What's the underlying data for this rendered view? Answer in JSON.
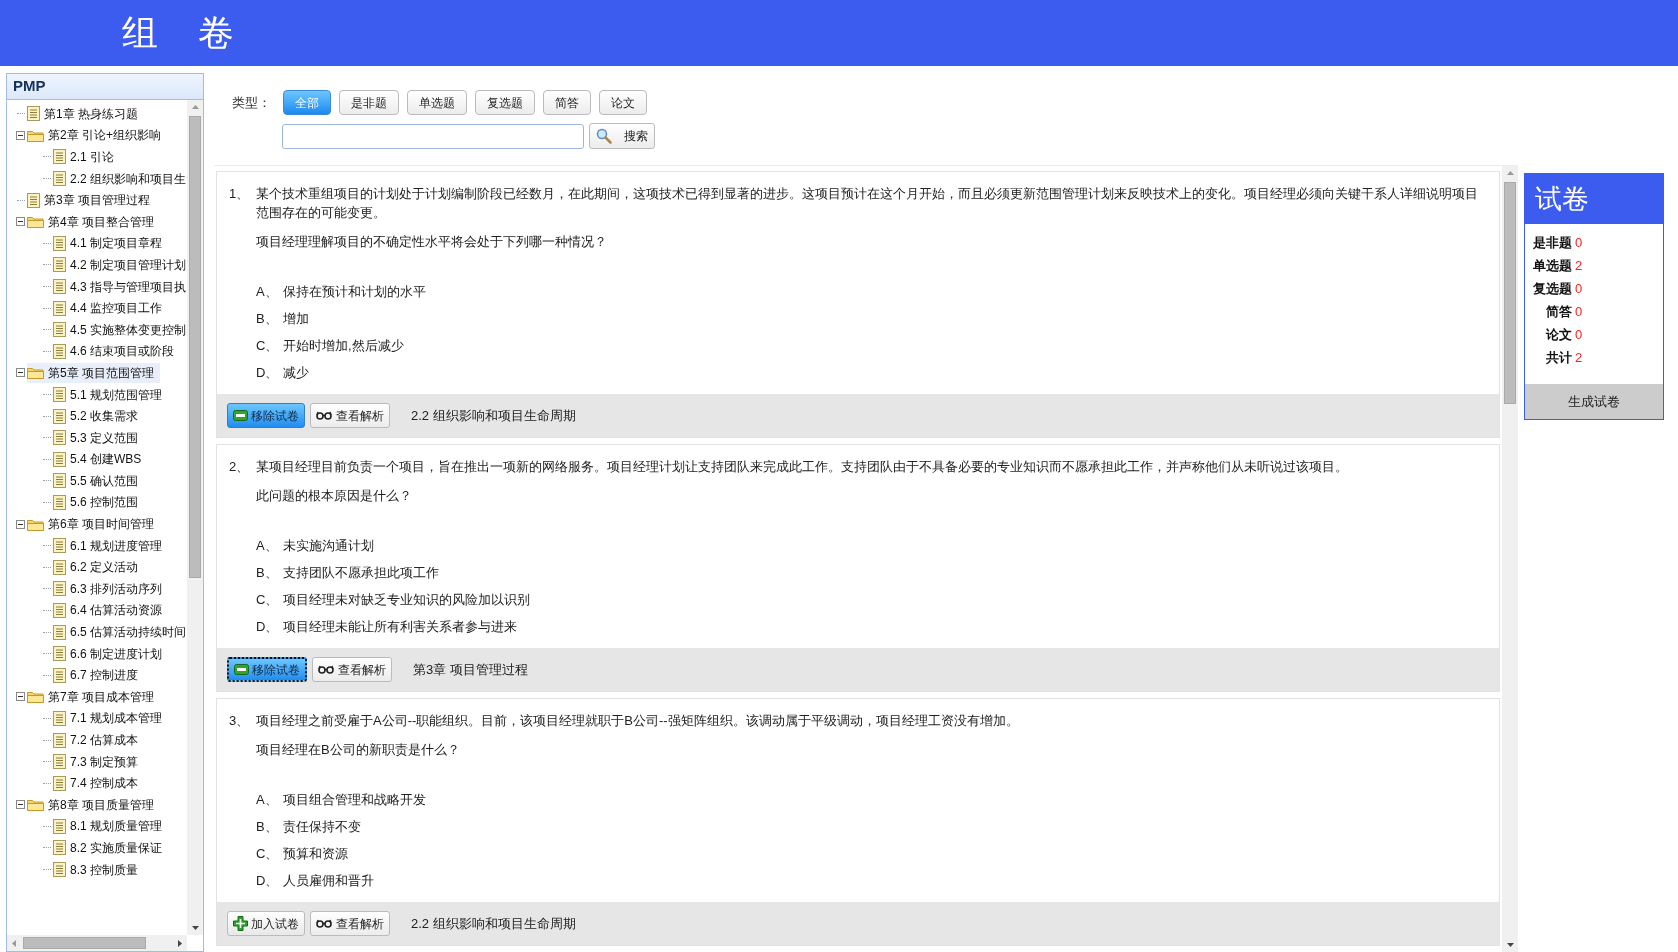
{
  "header": {
    "title": "组 卷"
  },
  "tree": {
    "title": "PMP",
    "items": [
      {
        "label": "第1章 热身练习题",
        "selected": false
      },
      {
        "label": "第2章 引论+组织影响",
        "selected": false,
        "expanded": true,
        "children": [
          {
            "label": "2.1 引论",
            "selected": false
          },
          {
            "label": "2.2 组织影响和项目生",
            "selected": false
          }
        ]
      },
      {
        "label": "第3章 项目管理过程",
        "selected": false
      },
      {
        "label": "第4章 项目整合管理",
        "selected": false,
        "expanded": true,
        "children": [
          {
            "label": "4.1 制定项目章程",
            "selected": false
          },
          {
            "label": "4.2 制定项目管理计划",
            "selected": false
          },
          {
            "label": "4.3 指导与管理项目执",
            "selected": false
          },
          {
            "label": "4.4 监控项目工作",
            "selected": false
          },
          {
            "label": "4.5 实施整体变更控制",
            "selected": false
          },
          {
            "label": "4.6 结束项目或阶段",
            "selected": false
          }
        ]
      },
      {
        "label": "第5章 项目范围管理",
        "selected": true,
        "expanded": true,
        "children": [
          {
            "label": "5.1 规划范围管理",
            "selected": false
          },
          {
            "label": "5.2 收集需求",
            "selected": false
          },
          {
            "label": "5.3 定义范围",
            "selected": false
          },
          {
            "label": "5.4 创建WBS",
            "selected": false
          },
          {
            "label": "5.5 确认范围",
            "selected": false
          },
          {
            "label": "5.6 控制范围",
            "selected": false
          }
        ]
      },
      {
        "label": "第6章 项目时间管理",
        "selected": false,
        "expanded": true,
        "children": [
          {
            "label": "6.1 规划进度管理",
            "selected": false
          },
          {
            "label": "6.2 定义活动",
            "selected": false
          },
          {
            "label": "6.3 排列活动序列",
            "selected": false
          },
          {
            "label": "6.4 估算活动资源",
            "selected": false
          },
          {
            "label": "6.5 估算活动持续时间",
            "selected": false
          },
          {
            "label": "6.6 制定进度计划",
            "selected": false
          },
          {
            "label": "6.7 控制进度",
            "selected": false
          }
        ]
      },
      {
        "label": "第7章 项目成本管理",
        "selected": false,
        "expanded": true,
        "children": [
          {
            "label": "7.1 规划成本管理",
            "selected": false
          },
          {
            "label": "7.2 估算成本",
            "selected": false
          },
          {
            "label": "7.3 制定预算",
            "selected": false
          },
          {
            "label": "7.4 控制成本",
            "selected": false
          }
        ]
      },
      {
        "label": "第8章 项目质量管理",
        "selected": false,
        "expanded": true,
        "children": [
          {
            "label": "8.1 规划质量管理",
            "selected": false
          },
          {
            "label": "8.2 实施质量保证",
            "selected": false
          },
          {
            "label": "8.3 控制质量",
            "selected": false
          }
        ]
      }
    ]
  },
  "filter": {
    "label": "类型：",
    "types": [
      {
        "label": "全部",
        "selected": true
      },
      {
        "label": "是非题",
        "selected": false
      },
      {
        "label": "单选题",
        "selected": false
      },
      {
        "label": "复选题",
        "selected": false
      },
      {
        "label": "简答",
        "selected": false
      },
      {
        "label": "论文",
        "selected": false
      }
    ],
    "search_button": "搜索"
  },
  "questions": [
    {
      "number": "1、",
      "stem": "某个技术重组项目的计划处于计划编制阶段已经数月，在此期间，这项技术已得到显著的进步。这项目预计在这个月开始，而且必须更新范围管理计划来反映技术上的变化。项目经理必须向关键干系人详细说明项目范围存在的可能变更。",
      "prompt": "项目经理理解项目的不确定性水平将会处于下列哪一种情况？",
      "options": [
        {
          "letter": "A、",
          "text": "保持在预计和计划的水平"
        },
        {
          "letter": "B、",
          "text": "增加"
        },
        {
          "letter": "C、",
          "text": "开始时增加,然后减少"
        },
        {
          "letter": "D、",
          "text": "减少"
        }
      ],
      "action": {
        "kind": "remove",
        "label": "移除试卷",
        "focused": false
      },
      "analysis_button": "查看解析",
      "section": "2.2 组织影响和项目生命周期"
    },
    {
      "number": "2、",
      "stem": "某项目经理目前负责一个项目，旨在推出一项新的网络服务。项目经理计划让支持团队来完成此工作。支持团队由于不具备必要的专业知识而不愿承担此工作，并声称他们从未听说过该项目。",
      "prompt": "此问题的根本原因是什么？",
      "options": [
        {
          "letter": "A、",
          "text": "未实施沟通计划"
        },
        {
          "letter": "B、",
          "text": "支持团队不愿承担此项工作"
        },
        {
          "letter": "C、",
          "text": "项目经理未对缺乏专业知识的风险加以识别"
        },
        {
          "letter": "D、",
          "text": "项目经理未能让所有利害关系者参与进来"
        }
      ],
      "action": {
        "kind": "remove",
        "label": "移除试卷",
        "focused": true
      },
      "analysis_button": "查看解析",
      "section": "第3章 项目管理过程"
    },
    {
      "number": "3、",
      "stem": "项目经理之前受雇于A公司--职能组织。目前，该项目经理就职于B公司--强矩阵组织。该调动属于平级调动，项目经理工资没有增加。",
      "prompt": "项目经理在B公司的新职责是什么？",
      "options": [
        {
          "letter": "A、",
          "text": "项目组合管理和战略开发"
        },
        {
          "letter": "B、",
          "text": "责任保持不变"
        },
        {
          "letter": "C、",
          "text": "预算和资源"
        },
        {
          "letter": "D、",
          "text": "人员雇佣和晋升"
        }
      ],
      "action": {
        "kind": "add",
        "label": "加入试卷",
        "focused": false
      },
      "analysis_button": "查看解析",
      "section": "2.2 组织影响和项目生命周期"
    }
  ],
  "paper": {
    "title": "试卷",
    "counts": [
      {
        "label": "是非题",
        "count": "0"
      },
      {
        "label": "单选题",
        "count": "2"
      },
      {
        "label": "复选题",
        "count": "0"
      },
      {
        "label": "简答",
        "count": "0"
      },
      {
        "label": "论文",
        "count": "0"
      },
      {
        "label": "共计",
        "count": "2"
      }
    ],
    "generate_button": "生成试卷"
  }
}
